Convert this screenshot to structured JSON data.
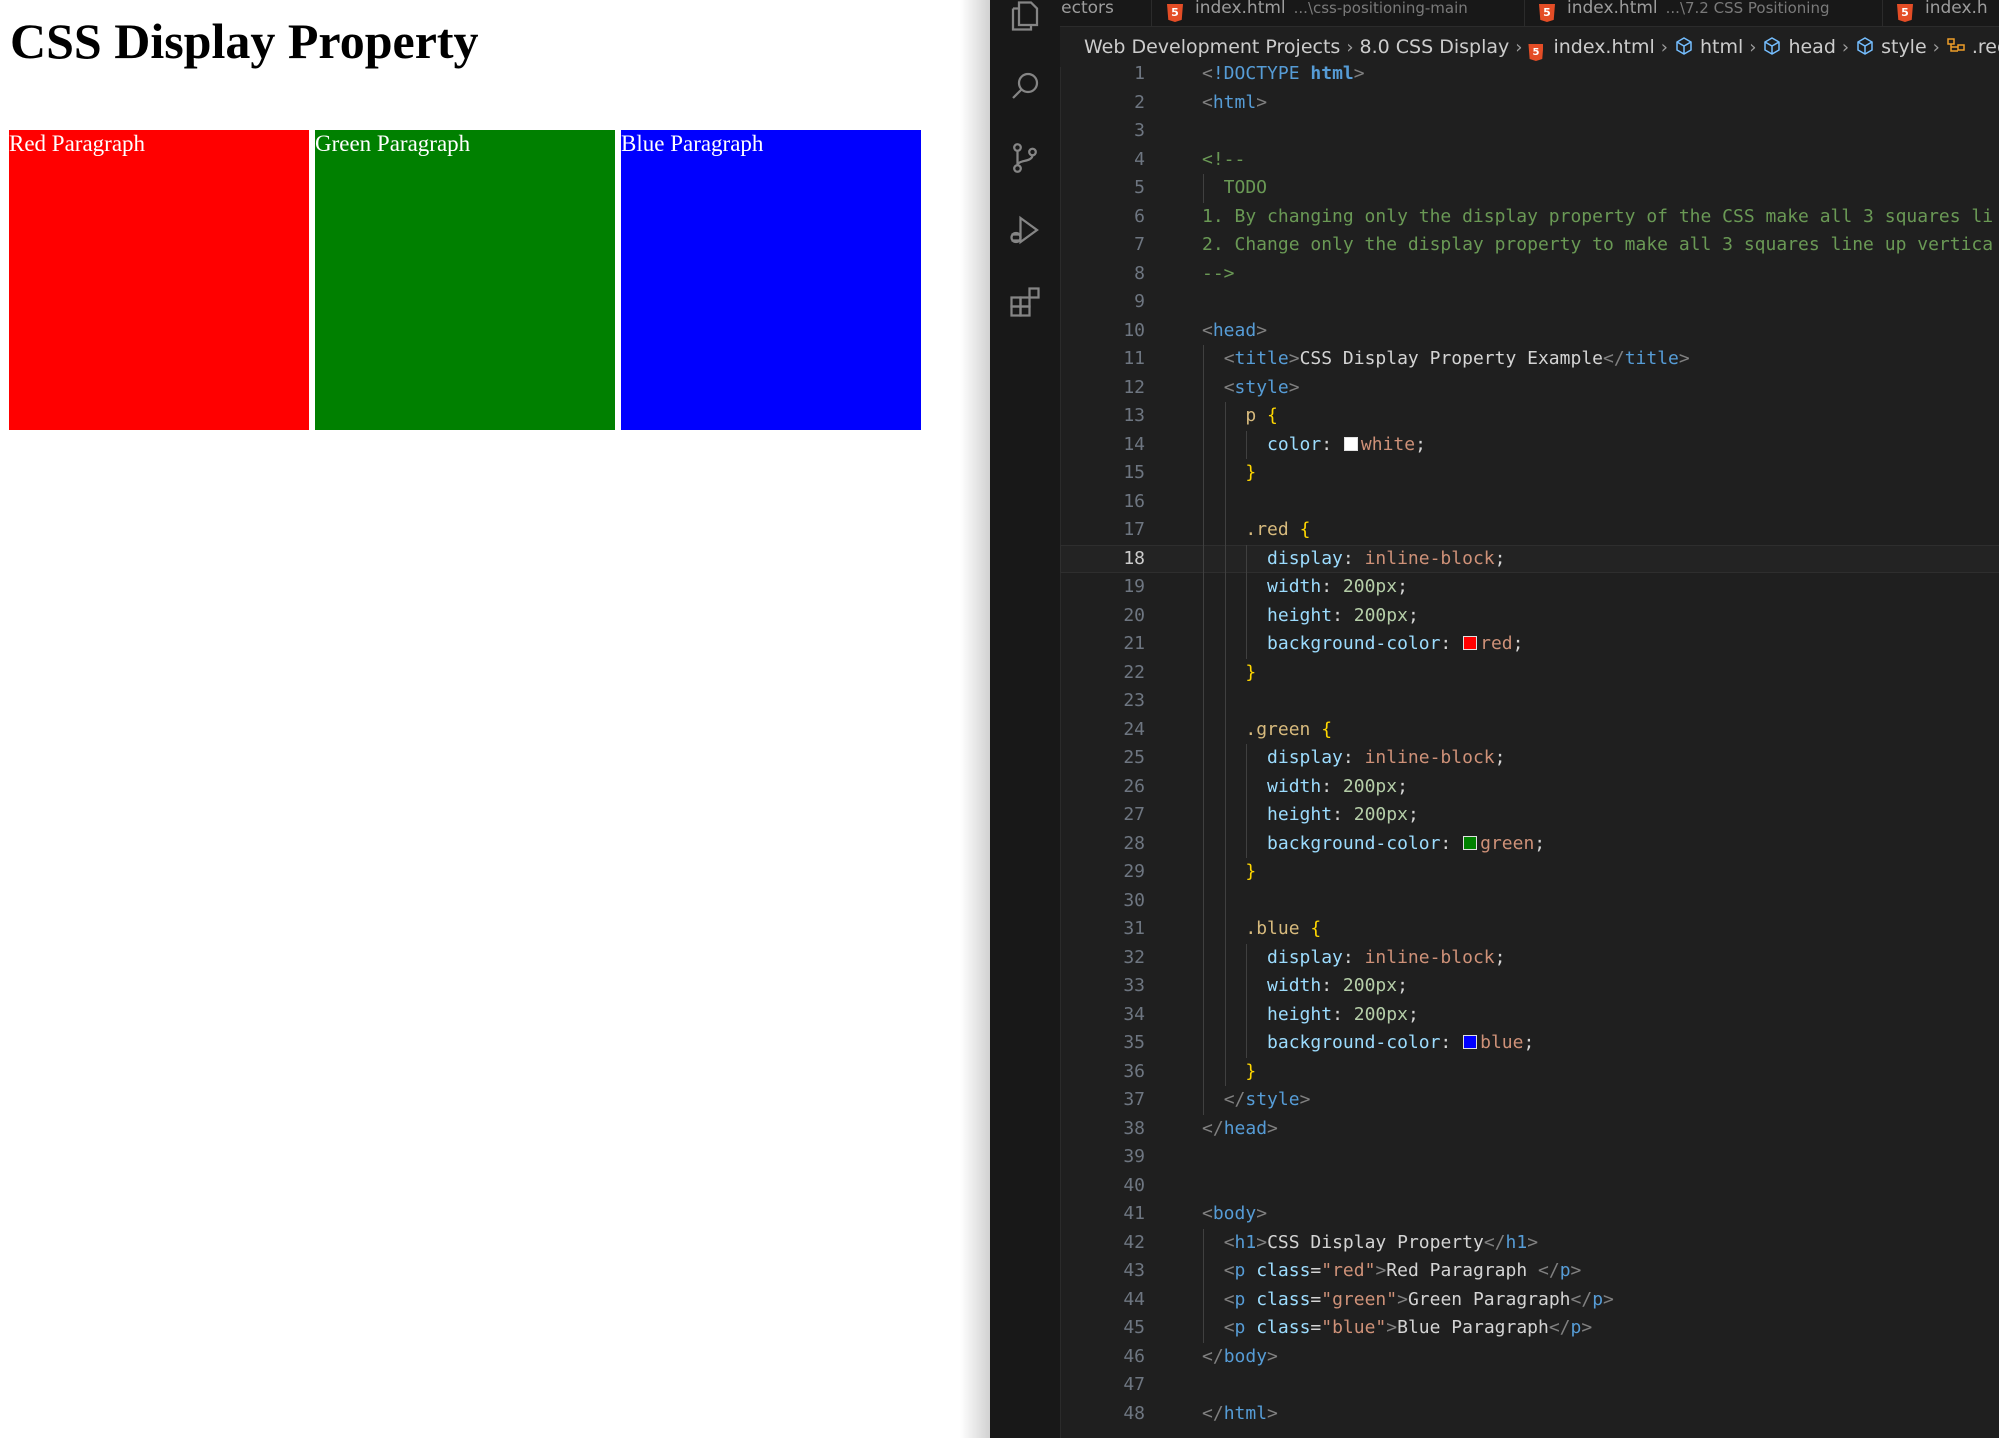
{
  "browser": {
    "heading": "CSS Display Property",
    "paragraphs": [
      {
        "label": "Red Paragraph",
        "color": "#ff0000"
      },
      {
        "label": "Green Paragraph",
        "color": "#008000"
      },
      {
        "label": "Blue Paragraph",
        "color": "#0000ff"
      }
    ]
  },
  "editor": {
    "tabs": [
      {
        "title": "electors",
        "hint": "",
        "html_icon": false
      },
      {
        "title": "index.html",
        "hint": "...\\css-positioning-main",
        "html_icon": true
      },
      {
        "title": "index.html",
        "hint": "...\\7.2 CSS Positioning",
        "html_icon": true
      },
      {
        "title": "index.h",
        "hint": "",
        "html_icon": true
      }
    ],
    "breadcrumb": [
      "Web Development Projects",
      "8.0 CSS Display",
      "index.html",
      "html",
      "head",
      "style",
      ".red"
    ],
    "current_line": 18,
    "lines": [
      [
        [
          "t-br",
          "<"
        ],
        [
          "t-tag",
          "!DOCTYPE "
        ],
        [
          "t-kw",
          "html"
        ],
        [
          "t-br",
          ">"
        ]
      ],
      [
        [
          "t-br",
          "<"
        ],
        [
          "t-tag",
          "html"
        ],
        [
          "t-br",
          ">"
        ]
      ],
      [],
      [
        [
          "t-cmt",
          "<!--"
        ]
      ],
      [
        [
          "t-cmt",
          "  TODO"
        ]
      ],
      [
        [
          "t-cmt",
          "1. By changing only the display property of the CSS make all 3 squares li"
        ]
      ],
      [
        [
          "t-cmt",
          "2. Change only the display property to make all 3 squares line up vertica"
        ]
      ],
      [
        [
          "t-cmt",
          "-->"
        ]
      ],
      [],
      [
        [
          "t-br",
          "<"
        ],
        [
          "t-tag",
          "head"
        ],
        [
          "t-br",
          ">"
        ]
      ],
      [
        [
          "t-txt",
          "  "
        ],
        [
          "t-br",
          "<"
        ],
        [
          "t-tag",
          "title"
        ],
        [
          "t-br",
          ">"
        ],
        [
          "t-txt",
          "CSS Display Property Example"
        ],
        [
          "t-br",
          "</"
        ],
        [
          "t-tag",
          "title"
        ],
        [
          "t-br",
          ">"
        ]
      ],
      [
        [
          "t-txt",
          "  "
        ],
        [
          "t-br",
          "<"
        ],
        [
          "t-tag",
          "style"
        ],
        [
          "t-br",
          ">"
        ]
      ],
      [
        [
          "t-txt",
          "    "
        ],
        [
          "t-sel",
          "p"
        ],
        [
          "t-txt",
          " "
        ],
        [
          "t-brace",
          "{"
        ]
      ],
      [
        [
          "t-txt",
          "      "
        ],
        [
          "t-prop",
          "color"
        ],
        [
          "t-txt",
          ": "
        ],
        [
          "swatch",
          "#ffffff"
        ],
        [
          "t-val",
          "white"
        ],
        [
          "t-txt",
          ";"
        ]
      ],
      [
        [
          "t-txt",
          "    "
        ],
        [
          "t-brace",
          "}"
        ]
      ],
      [],
      [
        [
          "t-txt",
          "    "
        ],
        [
          "t-sel",
          ".red"
        ],
        [
          "t-txt",
          " "
        ],
        [
          "t-brace",
          "{"
        ]
      ],
      [
        [
          "t-txt",
          "      "
        ],
        [
          "t-prop",
          "display"
        ],
        [
          "t-txt",
          ": "
        ],
        [
          "t-val",
          "inline-block"
        ],
        [
          "t-txt",
          ";"
        ]
      ],
      [
        [
          "t-txt",
          "      "
        ],
        [
          "t-prop",
          "width"
        ],
        [
          "t-txt",
          ": "
        ],
        [
          "t-num",
          "200px"
        ],
        [
          "t-txt",
          ";"
        ]
      ],
      [
        [
          "t-txt",
          "      "
        ],
        [
          "t-prop",
          "height"
        ],
        [
          "t-txt",
          ": "
        ],
        [
          "t-num",
          "200px"
        ],
        [
          "t-txt",
          ";"
        ]
      ],
      [
        [
          "t-txt",
          "      "
        ],
        [
          "t-prop",
          "background-color"
        ],
        [
          "t-txt",
          ": "
        ],
        [
          "swatch",
          "#ff0000"
        ],
        [
          "t-val",
          "red"
        ],
        [
          "t-txt",
          ";"
        ]
      ],
      [
        [
          "t-txt",
          "    "
        ],
        [
          "t-brace",
          "}"
        ]
      ],
      [],
      [
        [
          "t-txt",
          "    "
        ],
        [
          "t-sel",
          ".green"
        ],
        [
          "t-txt",
          " "
        ],
        [
          "t-brace",
          "{"
        ]
      ],
      [
        [
          "t-txt",
          "      "
        ],
        [
          "t-prop",
          "display"
        ],
        [
          "t-txt",
          ": "
        ],
        [
          "t-val",
          "inline-block"
        ],
        [
          "t-txt",
          ";"
        ]
      ],
      [
        [
          "t-txt",
          "      "
        ],
        [
          "t-prop",
          "width"
        ],
        [
          "t-txt",
          ": "
        ],
        [
          "t-num",
          "200px"
        ],
        [
          "t-txt",
          ";"
        ]
      ],
      [
        [
          "t-txt",
          "      "
        ],
        [
          "t-prop",
          "height"
        ],
        [
          "t-txt",
          ": "
        ],
        [
          "t-num",
          "200px"
        ],
        [
          "t-txt",
          ";"
        ]
      ],
      [
        [
          "t-txt",
          "      "
        ],
        [
          "t-prop",
          "background-color"
        ],
        [
          "t-txt",
          ": "
        ],
        [
          "swatch",
          "#008000"
        ],
        [
          "t-val",
          "green"
        ],
        [
          "t-txt",
          ";"
        ]
      ],
      [
        [
          "t-txt",
          "    "
        ],
        [
          "t-brace",
          "}"
        ]
      ],
      [],
      [
        [
          "t-txt",
          "    "
        ],
        [
          "t-sel",
          ".blue"
        ],
        [
          "t-txt",
          " "
        ],
        [
          "t-brace",
          "{"
        ]
      ],
      [
        [
          "t-txt",
          "      "
        ],
        [
          "t-prop",
          "display"
        ],
        [
          "t-txt",
          ": "
        ],
        [
          "t-val",
          "inline-block"
        ],
        [
          "t-txt",
          ";"
        ]
      ],
      [
        [
          "t-txt",
          "      "
        ],
        [
          "t-prop",
          "width"
        ],
        [
          "t-txt",
          ": "
        ],
        [
          "t-num",
          "200px"
        ],
        [
          "t-txt",
          ";"
        ]
      ],
      [
        [
          "t-txt",
          "      "
        ],
        [
          "t-prop",
          "height"
        ],
        [
          "t-txt",
          ": "
        ],
        [
          "t-num",
          "200px"
        ],
        [
          "t-txt",
          ";"
        ]
      ],
      [
        [
          "t-txt",
          "      "
        ],
        [
          "t-prop",
          "background-color"
        ],
        [
          "t-txt",
          ": "
        ],
        [
          "swatch",
          "#0000ff"
        ],
        [
          "t-val",
          "blue"
        ],
        [
          "t-txt",
          ";"
        ]
      ],
      [
        [
          "t-txt",
          "    "
        ],
        [
          "t-brace",
          "}"
        ]
      ],
      [
        [
          "t-txt",
          "  "
        ],
        [
          "t-br",
          "</"
        ],
        [
          "t-tag",
          "style"
        ],
        [
          "t-br",
          ">"
        ]
      ],
      [
        [
          "t-br",
          "</"
        ],
        [
          "t-tag",
          "head"
        ],
        [
          "t-br",
          ">"
        ]
      ],
      [],
      [],
      [
        [
          "t-br",
          "<"
        ],
        [
          "t-tag",
          "body"
        ],
        [
          "t-br",
          ">"
        ]
      ],
      [
        [
          "t-txt",
          "  "
        ],
        [
          "t-br",
          "<"
        ],
        [
          "t-tag",
          "h1"
        ],
        [
          "t-br",
          ">"
        ],
        [
          "t-txt",
          "CSS Display Property"
        ],
        [
          "t-br",
          "</"
        ],
        [
          "t-tag",
          "h1"
        ],
        [
          "t-br",
          ">"
        ]
      ],
      [
        [
          "t-txt",
          "  "
        ],
        [
          "t-br",
          "<"
        ],
        [
          "t-tag",
          "p"
        ],
        [
          "t-txt",
          " "
        ],
        [
          "t-attr",
          "class"
        ],
        [
          "t-txt",
          "="
        ],
        [
          "t-str",
          "\"red\""
        ],
        [
          "t-br",
          ">"
        ],
        [
          "t-txt",
          "Red Paragraph "
        ],
        [
          "t-br",
          "</"
        ],
        [
          "t-tag",
          "p"
        ],
        [
          "t-br",
          ">"
        ]
      ],
      [
        [
          "t-txt",
          "  "
        ],
        [
          "t-br",
          "<"
        ],
        [
          "t-tag",
          "p"
        ],
        [
          "t-txt",
          " "
        ],
        [
          "t-attr",
          "class"
        ],
        [
          "t-txt",
          "="
        ],
        [
          "t-str",
          "\"green\""
        ],
        [
          "t-br",
          ">"
        ],
        [
          "t-txt",
          "Green Paragraph"
        ],
        [
          "t-br",
          "</"
        ],
        [
          "t-tag",
          "p"
        ],
        [
          "t-br",
          ">"
        ]
      ],
      [
        [
          "t-txt",
          "  "
        ],
        [
          "t-br",
          "<"
        ],
        [
          "t-tag",
          "p"
        ],
        [
          "t-txt",
          " "
        ],
        [
          "t-attr",
          "class"
        ],
        [
          "t-txt",
          "="
        ],
        [
          "t-str",
          "\"blue\""
        ],
        [
          "t-br",
          ">"
        ],
        [
          "t-txt",
          "Blue Paragraph"
        ],
        [
          "t-br",
          "</"
        ],
        [
          "t-tag",
          "p"
        ],
        [
          "t-br",
          ">"
        ]
      ],
      [
        [
          "t-br",
          "</"
        ],
        [
          "t-tag",
          "body"
        ],
        [
          "t-br",
          ">"
        ]
      ],
      [],
      [
        [
          "t-br",
          "</"
        ],
        [
          "t-tag",
          "html"
        ],
        [
          "t-br",
          ">"
        ]
      ]
    ]
  }
}
